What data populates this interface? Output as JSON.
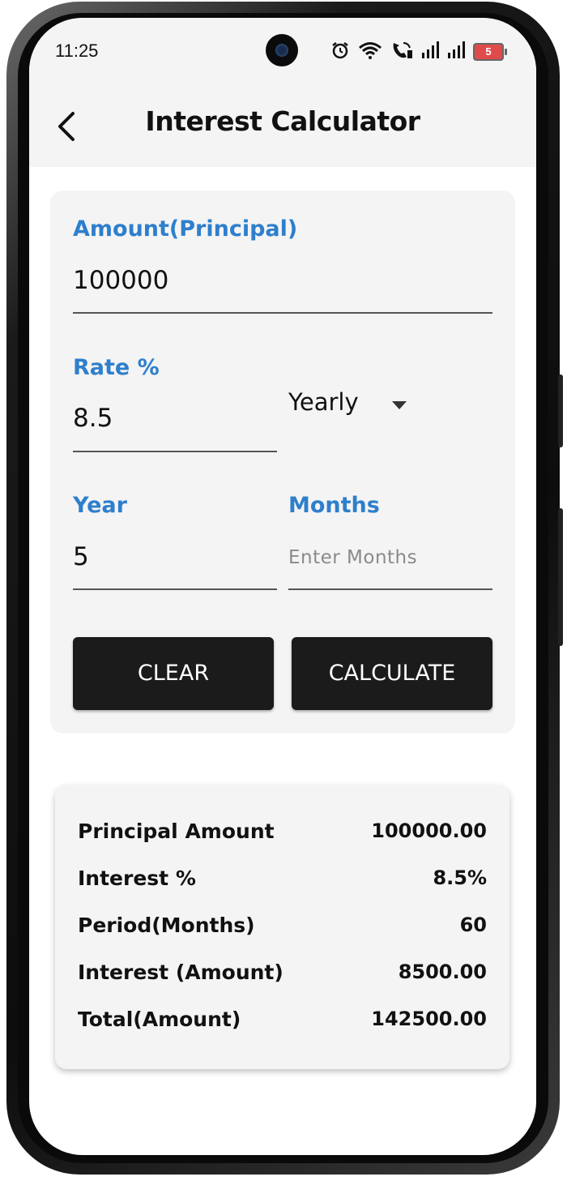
{
  "status_bar": {
    "time": "11:25",
    "battery_level": "5",
    "icons": [
      "alarm-icon",
      "wifi-icon",
      "wifi-call-icon",
      "signal-icon",
      "signal-icon",
      "battery-icon"
    ]
  },
  "app_bar": {
    "title": "Interest Calculator",
    "back_icon": "back-arrow-icon"
  },
  "form": {
    "amount": {
      "label": "Amount(Principal)",
      "value": "100000"
    },
    "rate": {
      "label": "Rate %",
      "value": "8.5"
    },
    "period_type": {
      "selected": "Yearly"
    },
    "year": {
      "label": "Year",
      "value": "5"
    },
    "months": {
      "label": "Months",
      "value": "",
      "placeholder": "Enter Months"
    },
    "clear_label": "CLEAR",
    "calculate_label": "CALCULATE"
  },
  "results": [
    {
      "label": "Principal Amount",
      "value": "100000.00"
    },
    {
      "label": "Interest %",
      "value": "8.5%"
    },
    {
      "label": "Period(Months)",
      "value": "60"
    },
    {
      "label": "Interest (Amount)",
      "value": "8500.00"
    },
    {
      "label": "Total(Amount)",
      "value": "142500.00"
    }
  ],
  "colors": {
    "label_blue": "#2e7fcc",
    "button_bg": "#1b1b1b",
    "card_bg": "#f4f4f4"
  }
}
